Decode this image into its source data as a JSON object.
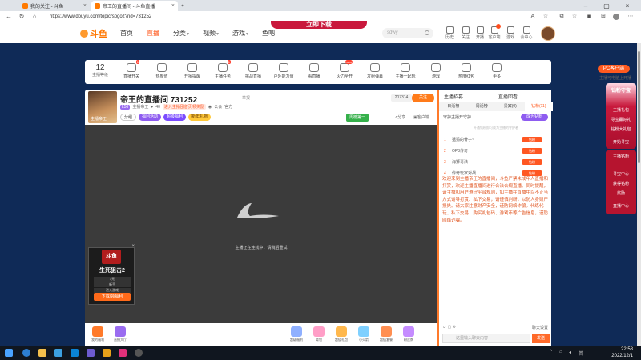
{
  "browser": {
    "tabs": [
      {
        "title": "我的关注 - 斗鱼"
      },
      {
        "title": "帝王的直播间 - 斗鱼直播"
      }
    ],
    "url": "https://www.douyu.com/topic/sogoz?rid=731252"
  },
  "site": {
    "logo": "斗鱼",
    "nav": [
      {
        "label": "首页"
      },
      {
        "label": "直播"
      },
      {
        "label": "分类"
      },
      {
        "label": "视频"
      },
      {
        "label": "游戏"
      },
      {
        "label": "鱼吧"
      }
    ],
    "promo": "立即下载",
    "search_placeholder": "sdwy",
    "header_icons": [
      {
        "label": "历史"
      },
      {
        "label": "关注"
      },
      {
        "label": "开播"
      },
      {
        "label": "客户端"
      },
      {
        "label": "游戏"
      },
      {
        "label": "会中心"
      }
    ]
  },
  "giftbar": {
    "level_num": "12",
    "level_text": "主播等级",
    "items": [
      {
        "label": "直播开关",
        "badge": "1"
      },
      {
        "label": "热度值",
        "badge": ""
      },
      {
        "label": "开播提醒",
        "badge": ""
      },
      {
        "label": "主播任务",
        "badge": "1"
      },
      {
        "label": "挑战直播",
        "badge": ""
      },
      {
        "label": "户外能力值",
        "badge": ""
      },
      {
        "label": "看直播",
        "badge": ""
      },
      {
        "label": "火力全开",
        "badge": "new"
      },
      {
        "label": "发射弹幕",
        "badge": ""
      },
      {
        "label": "主播一起玩",
        "badge": ""
      },
      {
        "label": "游戏",
        "badge": ""
      },
      {
        "label": "热度红包",
        "badge": ""
      },
      {
        "label": "更多",
        "badge": ""
      }
    ],
    "pc_button": "PC客户端",
    "pc_hint": "主播可电脑上开播"
  },
  "room": {
    "title": "帝王的直播间 731252",
    "report": "举报",
    "meta": [
      "主播帝王",
      "40",
      "进入主播团首页领奖励",
      "公会",
      "官方"
    ],
    "level": "L56",
    "pills": [
      "分组",
      "福利活动",
      "超级福利",
      "新年礼物"
    ],
    "follow_count": "207314",
    "follow_btn": "关注",
    "rank_btn": "周榜第一",
    "share": "分享",
    "report2": "客户端"
  },
  "video": {
    "message": "主播正在连线中，请稍后重试"
  },
  "ad": {
    "logo": "斗鱼",
    "title": "生死狙击2",
    "rows": [
      "1元",
      "新手",
      "进入游戏"
    ],
    "button": "下载/领福利"
  },
  "giftrow": {
    "items": [
      {
        "label": "我的福利",
        "color": "#ff7a2a"
      },
      {
        "label": "直播大厅",
        "color": "#9a6cf0"
      },
      {
        "label": "超级福利",
        "color": "#8fb0ff"
      },
      {
        "label": "背包",
        "color": "#ff9ec7"
      },
      {
        "label": "超值礼包",
        "color": "#ffb84d"
      },
      {
        "label": "小火箭",
        "color": "#7fd0ff"
      },
      {
        "label": "超值套餐",
        "color": "#ff8f52"
      },
      {
        "label": "粉丝牌",
        "color": "#c58cff"
      }
    ]
  },
  "chat": {
    "header_left": "主播招募",
    "header_right": "直播回看",
    "tabs": [
      "日活榜",
      "周活榜",
      "贵宾(0)",
      "钻粉(11)"
    ],
    "guard_text": "守护主播开守护",
    "guard_btn": "成为钻粉",
    "guard_hint": "开通钻粉即可成为主播的守护者",
    "rank": [
      {
        "num": "1",
        "name": "猛犸的骨子~",
        "tag": "钻粉"
      },
      {
        "num": "2",
        "name": "OP3传奇",
        "tag": "钻粉"
      },
      {
        "num": "3",
        "name": "海狮哥法",
        "tag": "钻粉"
      },
      {
        "num": "4",
        "name": "传奇玩家对战",
        "tag": "钻粉"
      }
    ],
    "notice": "欢迎来到主播帝王的直播间，斗鱼严禁未成年人直播和打赏，欢迎主播直播间进行合法合规直播。同时提醒，请主播和用户遵守平台规则，如主播在直播中以不正当方式诱导打赏、私下交易，请谨慎判断，以防人身财产损失。请大家注意财产安全，谨防网络诈骗。代练代玩、私下交易、购买礼包码、游戏币等广告信息，谨防网络诈骗。",
    "tools_right": "聊天设置",
    "input_placeholder": "这里输入聊天内容",
    "send": "发送"
  },
  "side_ads": {
    "ad1": [
      "钻粉守宝",
      "主播礼包",
      "寻宝赢好礼",
      "钻粉大礼包",
      "开始寻宝"
    ],
    "ad2": [
      "主播钻粉",
      "寻宝中心",
      "获得钻粉",
      "奖励",
      "直播中心"
    ]
  },
  "taskbar": {
    "time": "22:58",
    "date": "2022/12/1"
  }
}
